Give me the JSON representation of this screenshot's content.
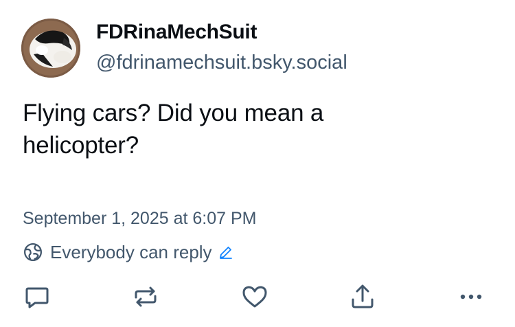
{
  "author": {
    "display_name": "FDRinaMechSuit",
    "handle": "@fdrinamechsuit.bsky.social"
  },
  "post": {
    "text": "Flying cars? Did you mean a helicopter?",
    "timestamp": "September 1, 2025 at 6:07 PM"
  },
  "reply_settings": {
    "label": "Everybody can reply"
  },
  "actions": [
    {
      "name": "reply",
      "icon": "speech-bubble-icon"
    },
    {
      "name": "repost",
      "icon": "repost-arrows-icon"
    },
    {
      "name": "like",
      "icon": "heart-icon"
    },
    {
      "name": "share",
      "icon": "share-upload-icon"
    },
    {
      "name": "more",
      "icon": "ellipsis-icon"
    }
  ],
  "colors": {
    "text": "#0b0f14",
    "muted": "#42576c",
    "accent": "#1083fe"
  }
}
